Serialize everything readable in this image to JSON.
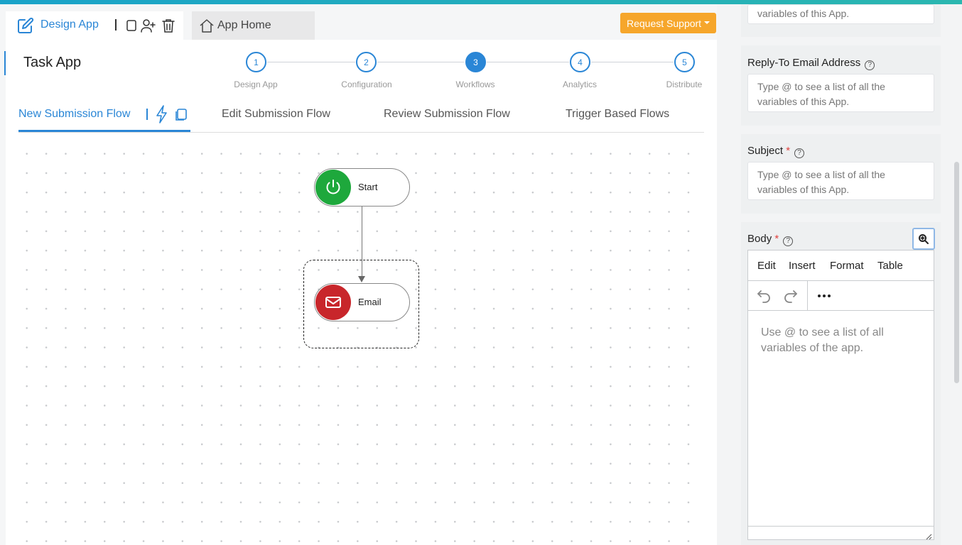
{
  "header": {
    "design_tab_label": "Design App",
    "home_tab_label": "App Home",
    "support_button_label": "Request Support",
    "accent_color": "#2a86d6",
    "support_color": "#f6a62b"
  },
  "app": {
    "title": "Task App"
  },
  "stepper": {
    "steps": [
      {
        "number": "1",
        "label": "Design App"
      },
      {
        "number": "2",
        "label": "Configuration"
      },
      {
        "number": "3",
        "label": "Workflows"
      },
      {
        "number": "4",
        "label": "Analytics"
      },
      {
        "number": "5",
        "label": "Distribute"
      }
    ],
    "active_step": "3"
  },
  "flow_tabs": [
    {
      "label": "New Submission Flow"
    },
    {
      "label": "Edit Submission Flow"
    },
    {
      "label": "Review Submission Flow"
    },
    {
      "label": "Trigger Based Flows"
    }
  ],
  "canvas": {
    "nodes": [
      {
        "label": "Start",
        "icon": "power-icon",
        "color": "#1ea83c"
      },
      {
        "label": "Email",
        "icon": "mail-icon",
        "color": "#c8262b"
      }
    ]
  },
  "panel": {
    "top_input_text": "variables of this App.",
    "reply_to": {
      "label": "Reply-To Email Address",
      "placeholder": "Type @ to see a list of all the variables of this App."
    },
    "subject": {
      "label": "Subject",
      "required_mark": "*",
      "placeholder": "Type @ to see a list of all the variables of this App."
    },
    "body": {
      "label": "Body",
      "required_mark": "*",
      "menu": [
        "Edit",
        "Insert",
        "Format",
        "Table"
      ],
      "placeholder": "Use @ to see a list of all variables of the app."
    },
    "help_glyph": "?"
  }
}
